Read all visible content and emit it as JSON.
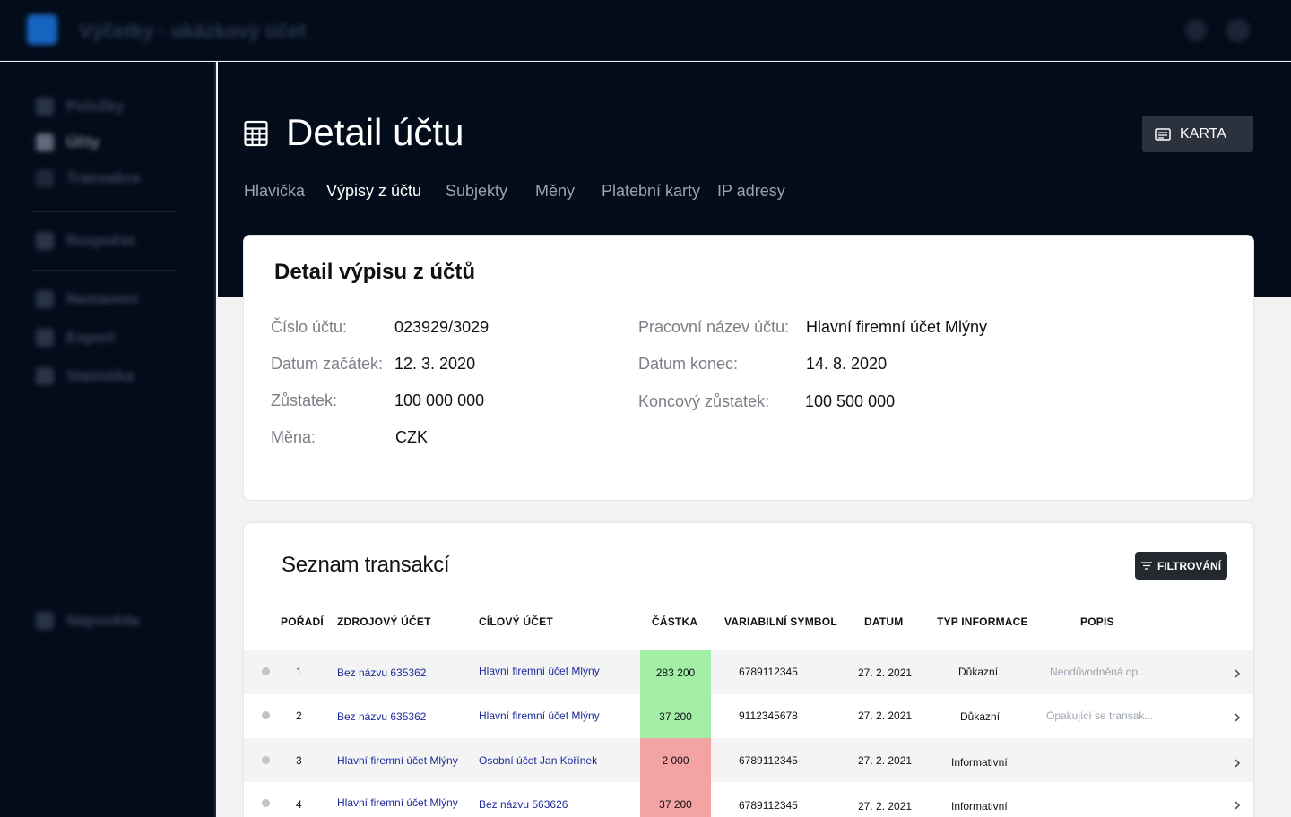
{
  "topbar": {
    "title": "Výčetky · ukázkový účet"
  },
  "sidebar": {
    "items": [
      {
        "label": "Položky"
      },
      {
        "label": "Účty"
      },
      {
        "label": "Transakce"
      },
      {
        "label": "Rozpočet"
      },
      {
        "label": "Nastavení"
      },
      {
        "label": "Export"
      },
      {
        "label": "Statistika"
      },
      {
        "label": "Nápověda"
      }
    ]
  },
  "page": {
    "title": "Detail účtu",
    "karta_label": "KARTA",
    "tabs": [
      {
        "label": "Hlavička"
      },
      {
        "label": "Výpisy z účtu"
      },
      {
        "label": "Subjekty"
      },
      {
        "label": "Měny"
      },
      {
        "label": "Platební karty"
      },
      {
        "label": "IP adresy"
      }
    ],
    "active_tab": "Výpisy z účtu"
  },
  "detail": {
    "title": "Detail výpisu z účtů",
    "fields": {
      "account_number": {
        "label": "Číslo účtu:",
        "value": "023929/3029"
      },
      "work_name": {
        "label": "Pracovní název účtu:",
        "value": "Hlavní firemní účet Mlýny"
      },
      "date_start": {
        "label": "Datum začátek:",
        "value": "12. 3. 2020"
      },
      "date_end": {
        "label": "Datum konec:",
        "value": "14. 8. 2020"
      },
      "balance": {
        "label": "Zůstatek:",
        "value": "100 000 000"
      },
      "end_balance": {
        "label": "Koncový zůstatek:",
        "value": "100 500 000"
      },
      "currency": {
        "label": "Měna:",
        "value": "CZK"
      }
    }
  },
  "transactions": {
    "title": "Seznam transakcí",
    "filter_label": "FILTROVÁNÍ",
    "columns": [
      "POŘADÍ",
      "ZDROJOVÝ ÚČET",
      "CÍLOVÝ ÚČET",
      "ČÁSTKA",
      "VARIABILNÍ SYMBOL",
      "DATUM",
      "TYP INFORMACE",
      "POPIS"
    ],
    "rows": [
      {
        "order": "1",
        "source": "Bez názvu 635362",
        "target": "Hlavní firemní účet Mlýny",
        "amount": "283 200",
        "amount_type": "positive",
        "vs": "6789112345",
        "date": "27. 2. 2021",
        "info_type": "Důkazní",
        "description": "Neodůvodněná op..."
      },
      {
        "order": "2",
        "source": "Bez názvu 635362",
        "target": "Hlavní firemní účet Mlýny",
        "amount": "37 200",
        "amount_type": "positive",
        "vs": "9112345678",
        "date": "27. 2. 2021",
        "info_type": "Důkazní",
        "description": "Opakující se transak..."
      },
      {
        "order": "3",
        "source": "Hlavní firemní účet Mlýny",
        "target": "Osobní účet Jan Kořínek",
        "amount": "2 000",
        "amount_type": "negative",
        "vs": "6789112345",
        "date": "27. 2. 2021",
        "info_type": "Informativní",
        "description": ""
      },
      {
        "order": "4",
        "source": "Hlavní firemní účet Mlýny",
        "target": "Bez názvu 563626",
        "amount": "37 200",
        "amount_type": "negative",
        "vs": "6789112345",
        "date": "27. 2. 2021",
        "info_type": "Informativní",
        "description": ""
      }
    ]
  },
  "colors": {
    "dark_bg": "#030c1a",
    "positive": "#a3efa8",
    "negative": "#f4a3a3",
    "link": "#1f2a9b"
  }
}
